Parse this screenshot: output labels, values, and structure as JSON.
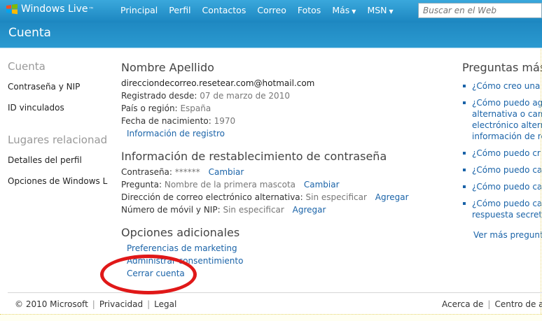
{
  "brand": {
    "name": "Windows Live",
    "tm": "™"
  },
  "nav": [
    {
      "label": "Principal",
      "caret": ""
    },
    {
      "label": "Perfil",
      "caret": ""
    },
    {
      "label": "Contactos",
      "caret": ""
    },
    {
      "label": "Correo",
      "caret": ""
    },
    {
      "label": "Fotos",
      "caret": ""
    },
    {
      "label": "Más",
      "caret": "▼"
    },
    {
      "label": "MSN",
      "caret": "▼"
    }
  ],
  "search": {
    "placeholder": "Buscar en el Web"
  },
  "page_title": "Cuenta",
  "sidebar": {
    "section1": "Cuenta",
    "links1": [
      "Contraseña y NIP",
      "ID vinculados"
    ],
    "section2": "Lugares relacionad",
    "links2": [
      "Detalles del perfil",
      "Opciones de Windows L"
    ]
  },
  "profile": {
    "name": "Nombre Apellido",
    "email": "direcciondecorreo.resetear.com@hotmail.com",
    "registered_label": "Registrado desde:",
    "registered_value": "07 de marzo de 2010",
    "country_label": "País o región:",
    "country_value": "España",
    "birth_label": "Fecha de nacimiento:",
    "birth_value": "1970",
    "info_link": "Información de registro"
  },
  "reset": {
    "title": "Información de restablecimiento de contraseña",
    "password_label": "Contraseña:",
    "password_value": "******",
    "password_action": "Cambiar",
    "question_label": "Pregunta:",
    "question_value": "Nombre de la primera mascota",
    "question_action": "Cambiar",
    "alt_email_label": "Dirección de correo electrónico alternativa:",
    "alt_email_value": "Sin especificar",
    "alt_email_action": "Agregar",
    "mobile_label": "Número de móvil y NIP:",
    "mobile_value": "Sin especificar",
    "mobile_action": "Agregar"
  },
  "options": {
    "title": "Opciones adicionales",
    "links": [
      "Preferencias de marketing",
      "Administrar consentimiento",
      "Cerrar cuenta"
    ]
  },
  "faq": {
    "title": "Preguntas más",
    "items": [
      [
        "¿Cómo creo una"
      ],
      [
        "¿Cómo puedo ag",
        "alternativa o cam",
        "electrónico altern",
        "información de re"
      ],
      [
        "¿Cómo puedo cr"
      ],
      [
        "¿Cómo puedo ca"
      ],
      [
        "¿Cómo puedo ca"
      ],
      [
        "¿Cómo puedo ca",
        "respuesta secreta"
      ]
    ],
    "more": "Ver más pregunt"
  },
  "footer": {
    "copyright": "© 2010 Microsoft",
    "privacy": "Privacidad",
    "legal": "Legal",
    "about": "Acerca de",
    "center": "Centro de a"
  },
  "colors": {
    "bar": "#1f8fc8",
    "link": "#1a63a8",
    "annotation": "#e01818"
  }
}
